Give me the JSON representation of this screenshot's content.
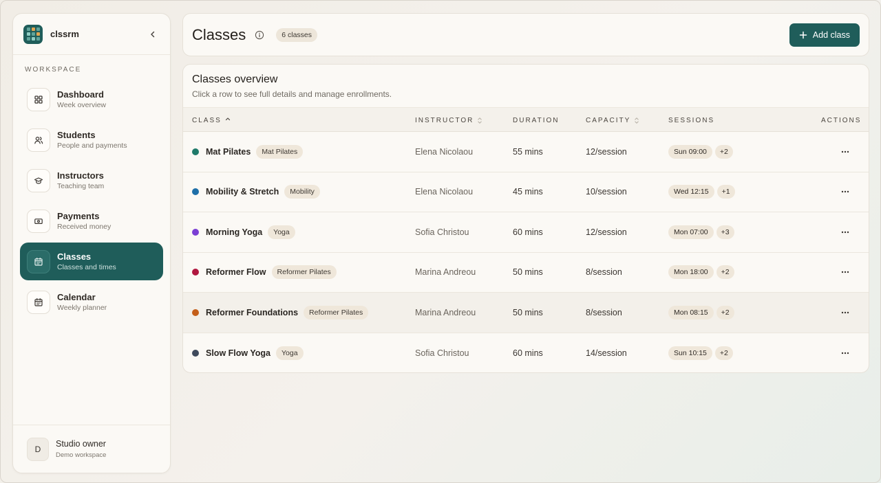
{
  "brand": {
    "name": "clssrm"
  },
  "sidebar": {
    "section_label": "WORKSPACE",
    "items": [
      {
        "title": "Dashboard",
        "subtitle": "Week overview",
        "icon": "grid-icon",
        "active": false
      },
      {
        "title": "Students",
        "subtitle": "People and payments",
        "icon": "users-icon",
        "active": false
      },
      {
        "title": "Instructors",
        "subtitle": "Teaching team",
        "icon": "graduation-cap-icon",
        "active": false
      },
      {
        "title": "Payments",
        "subtitle": "Received money",
        "icon": "banknote-icon",
        "active": false
      },
      {
        "title": "Classes",
        "subtitle": "Classes and times",
        "icon": "calendar-icon",
        "active": true
      },
      {
        "title": "Calendar",
        "subtitle": "Weekly planner",
        "icon": "calendar-icon",
        "active": false
      }
    ],
    "owner": {
      "initial": "D",
      "name": "Studio owner",
      "subtitle": "Demo workspace"
    }
  },
  "header": {
    "title": "Classes",
    "count_badge": "6 classes",
    "add_button": "Add class"
  },
  "overview": {
    "title": "Classes overview",
    "subtitle": "Click a row to see full details and manage enrollments."
  },
  "table": {
    "columns": {
      "class": "CLASS",
      "instructor": "INSTRUCTOR",
      "duration": "DURATION",
      "capacity": "CAPACITY",
      "sessions": "SESSIONS",
      "actions": "ACTIONS"
    },
    "rows": [
      {
        "name": "Mat Pilates",
        "tag": "Mat Pilates",
        "color": "#1f7a6a",
        "instructor": "Elena Nicolaou",
        "duration": "55 mins",
        "capacity": "12/session",
        "session": "Sun 09:00",
        "more": "+2"
      },
      {
        "name": "Mobility & Stretch",
        "tag": "Mobility",
        "color": "#1e6fa8",
        "instructor": "Elena Nicolaou",
        "duration": "45 mins",
        "capacity": "10/session",
        "session": "Wed 12:15",
        "more": "+1"
      },
      {
        "name": "Morning Yoga",
        "tag": "Yoga",
        "color": "#7b3fd4",
        "instructor": "Sofia Christou",
        "duration": "60 mins",
        "capacity": "12/session",
        "session": "Mon 07:00",
        "more": "+3"
      },
      {
        "name": "Reformer Flow",
        "tag": "Reformer Pilates",
        "color": "#b0173f",
        "instructor": "Marina Andreou",
        "duration": "50 mins",
        "capacity": "8/session",
        "session": "Mon 18:00",
        "more": "+2"
      },
      {
        "name": "Reformer Foundations",
        "tag": "Reformer Pilates",
        "color": "#c45f1a",
        "instructor": "Marina Andreou",
        "duration": "50 mins",
        "capacity": "8/session",
        "session": "Mon 08:15",
        "more": "+2"
      },
      {
        "name": "Slow Flow Yoga",
        "tag": "Yoga",
        "color": "#3f4a5c",
        "instructor": "Sofia Christou",
        "duration": "60 mins",
        "capacity": "14/session",
        "session": "Sun 10:15",
        "more": "+2"
      }
    ]
  },
  "colors": {
    "accent": "#1f5d5a",
    "card": "#fbf9f5",
    "badge": "#efe7da"
  }
}
